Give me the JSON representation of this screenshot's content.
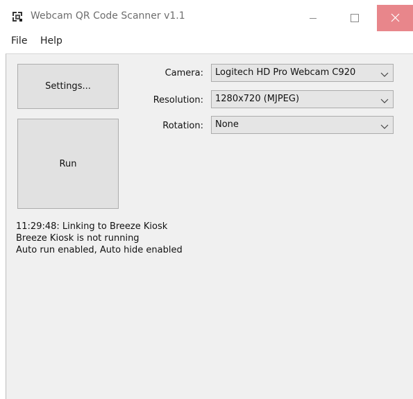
{
  "window": {
    "title": "Webcam QR Code Scanner v1.1"
  },
  "menu": {
    "file": "File",
    "help": "Help"
  },
  "buttons": {
    "settings": "Settings...",
    "run": "Run"
  },
  "fields": {
    "camera": {
      "label": "Camera:",
      "value": "Logitech HD Pro Webcam C920"
    },
    "resolution": {
      "label": "Resolution:",
      "value": "1280x720 (MJPEG)"
    },
    "rotation": {
      "label": "Rotation:",
      "value": "None"
    }
  },
  "log": {
    "lines": [
      "11:29:48: Linking to Breeze Kiosk",
      "Breeze Kiosk is not running",
      "Auto run enabled, Auto hide enabled"
    ]
  },
  "icons": {
    "app": "qr-scanner-icon",
    "minimize": "minimize-icon",
    "maximize": "maximize-icon",
    "close": "close-icon",
    "dropdown": "chevron-down-icon"
  },
  "colors": {
    "close_button": "#e8868b",
    "client_background": "#f0f0f0",
    "button_face": "#e1e1e1"
  }
}
